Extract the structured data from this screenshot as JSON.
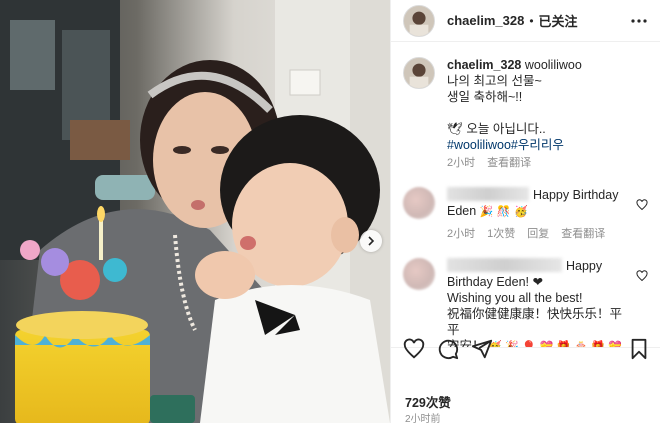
{
  "post": {
    "username": "chaelim_328",
    "follow_state": "已关注",
    "separator": "•",
    "caption": {
      "tag_user": "wooliliwoo",
      "lines": [
        "나의 최고의 선물~",
        "생일 축하해~!!"
      ],
      "note": "🕊 오늘 아닙니다..",
      "hashtags": "#wooliliwoo#우리리우",
      "time": "2小时",
      "translate": "查看翻译"
    },
    "comments": [
      {
        "text_tail": "Happy Birthday",
        "text_line2": "Eden",
        "emojis": "🎉 🎊 🥳",
        "time": "2小时",
        "likes": "1次赞",
        "reply": "回复",
        "translate": "查看翻译"
      },
      {
        "text_tail": "Happy",
        "text_line2": "Birthday Eden! ❤",
        "line3": "Wishing you all the best!",
        "line4": "祝福你健健康康！快快乐乐！平平",
        "line5": "安安！",
        "emojis": "🥳 🎉 🎈 💝 🎁 🎂 🎁 💝 🎈",
        "emojis2": "🎉 🥳"
      }
    ],
    "likes": "729次赞",
    "time": "2小时前"
  },
  "icons": {
    "more": "more-horizontal-icon",
    "heart": "heart-icon",
    "comment": "comment-icon",
    "share": "share-icon",
    "save": "bookmark-icon",
    "next": "chevron-right-icon"
  }
}
